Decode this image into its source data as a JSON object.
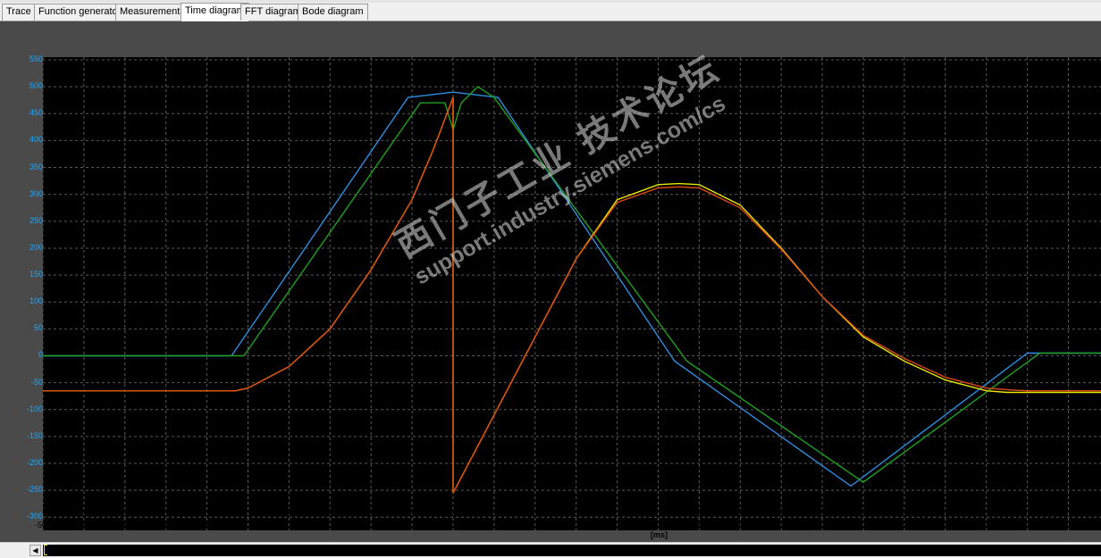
{
  "tabs": [
    {
      "label": "Trace",
      "active": false
    },
    {
      "label": "Function generator",
      "active": false
    },
    {
      "label": "Measurements",
      "active": false
    },
    {
      "label": "Time diagram",
      "active": true
    },
    {
      "label": "FFT diagram",
      "active": false
    },
    {
      "label": "Bode diagram",
      "active": false
    }
  ],
  "watermark": {
    "line1": "西门子工业 技术论坛",
    "line2": "support.industry.siemens.com/cs"
  },
  "colors": {
    "background": "#000000",
    "grid": "#5a5a5a",
    "y_tick_labels": "#1aa8ff"
  },
  "chart_data": {
    "type": "line",
    "xlabel": "[ms]",
    "ylabel": "",
    "xlim": [
      -500,
      2080
    ],
    "ylim": [
      -320,
      555
    ],
    "x_ticks": [
      -500,
      -400,
      -300,
      -200,
      -100,
      0,
      100,
      200,
      300,
      400,
      500,
      600,
      700,
      800,
      900,
      1000,
      1100,
      1200,
      1300,
      1400,
      1500,
      1600,
      1700,
      1800,
      1900,
      2000
    ],
    "y_ticks": [
      550,
      500,
      450,
      400,
      350,
      300,
      250,
      200,
      150,
      100,
      50,
      0,
      -50,
      -100,
      -150,
      -200,
      -250,
      -300
    ],
    "grid": true,
    "series": [
      {
        "color": "#2f8ce0",
        "x": [
          -500,
          -40,
          390,
          500,
          610,
          1040,
          1470,
          1900,
          2080
        ],
        "y": [
          0,
          0,
          480,
          490,
          480,
          -10,
          -242,
          5,
          5
        ]
      },
      {
        "color": "#1fa01f",
        "x": [
          -500,
          -10,
          420,
          480,
          500,
          520,
          560,
          600,
          1070,
          1500,
          1930,
          2080
        ],
        "y": [
          0,
          0,
          470,
          470,
          420,
          470,
          500,
          480,
          -10,
          -235,
          5,
          5
        ]
      },
      {
        "color": "#e8e800",
        "x": [
          -500,
          -30,
          0,
          100,
          200,
          300,
          400,
          450,
          500,
          500,
          800,
          900,
          1000,
          1050,
          1100,
          1200,
          1300,
          1400,
          1500,
          1600,
          1700,
          1800,
          1850,
          1900,
          2000,
          2080
        ],
        "y": [
          -65,
          -65,
          -60,
          -20,
          50,
          160,
          290,
          380,
          480,
          -255,
          180,
          290,
          318,
          320,
          318,
          280,
          200,
          110,
          35,
          -10,
          -45,
          -65,
          -68,
          -68,
          -68,
          -68
        ]
      },
      {
        "color": "#e04a10",
        "x": [
          -500,
          -30,
          0,
          100,
          200,
          300,
          400,
          450,
          500,
          500,
          800,
          900,
          1000,
          1050,
          1100,
          1200,
          1300,
          1400,
          1500,
          1600,
          1700,
          1800,
          1850,
          1900,
          2000,
          2080
        ],
        "y": [
          -65,
          -65,
          -60,
          -20,
          50,
          160,
          290,
          380,
          480,
          -255,
          180,
          285,
          312,
          314,
          312,
          275,
          198,
          110,
          38,
          -5,
          -40,
          -60,
          -63,
          -65,
          -65,
          -65
        ]
      }
    ]
  }
}
